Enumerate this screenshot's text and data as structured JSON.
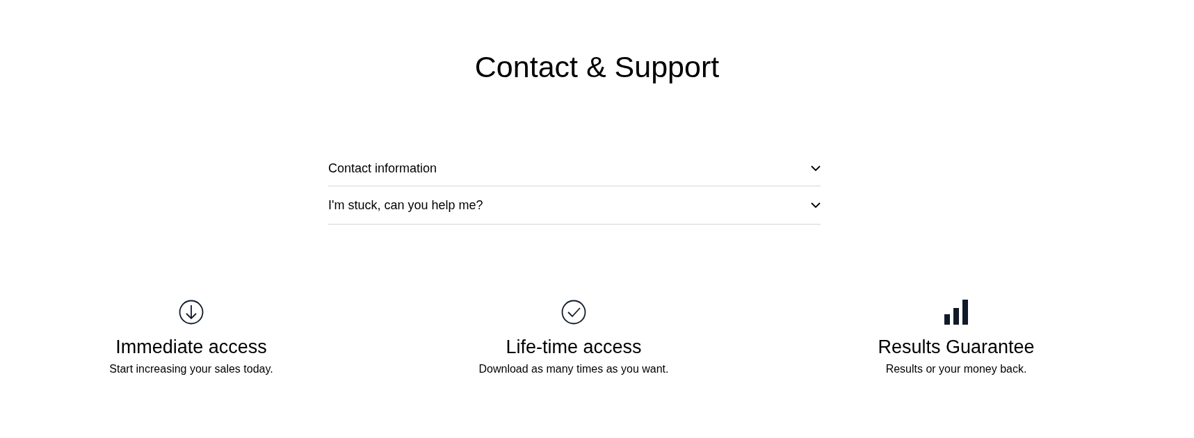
{
  "title": "Contact & Support",
  "faq": [
    {
      "question": "Contact information",
      "expanded": false
    },
    {
      "question": "I'm stuck, can you help me?",
      "expanded": false
    }
  ],
  "features": [
    {
      "kind": "download",
      "title": "Immediate access",
      "text": "Start increasing your sales today."
    },
    {
      "kind": "check",
      "title": "Life-time access",
      "text": "Download as many times as you want."
    },
    {
      "kind": "bars",
      "title": "Results Guarantee",
      "text": "Results or your money back."
    }
  ]
}
